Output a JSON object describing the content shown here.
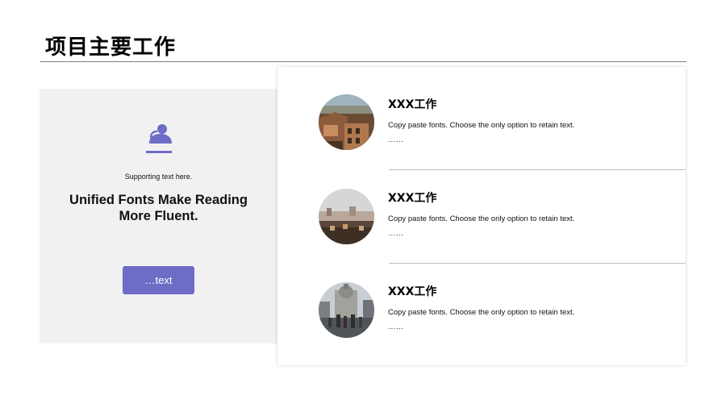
{
  "page": {
    "title": "项目主要工作"
  },
  "left_panel": {
    "icon": "user-icon",
    "supporting_text": "Supporting text here.",
    "headline": "Unified Fonts Make Reading More Fluent.",
    "button_label": "…text"
  },
  "colors": {
    "accent": "#6d6cc6",
    "panel_bg": "#f1f1f2",
    "divider": "#bdbdbd"
  },
  "items": [
    {
      "title": "XXX工作",
      "description": "Copy paste fonts. Choose the only option to retain text.",
      "more": "……"
    },
    {
      "title": "XXX工作",
      "description": "Copy paste fonts. Choose the only option to retain text.",
      "more": "……"
    },
    {
      "title": "XXX工作",
      "description": "Copy paste fonts. Choose the only option to retain text.",
      "more": "……"
    }
  ]
}
